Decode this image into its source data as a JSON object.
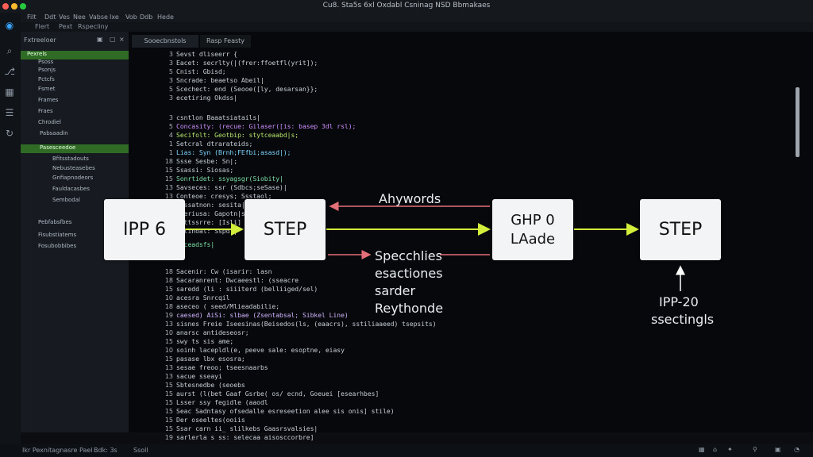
{
  "window": {
    "title": "Cu8. Sta5s 6xl Oxdabl Csninag NSD Bbmakaes",
    "controls": [
      "close",
      "minimize",
      "maximize"
    ]
  },
  "menu": [
    "Filt",
    "Ddt",
    "Ves",
    "Nee",
    "Vabse",
    "Ixe",
    "Vob",
    "Ddb",
    "Hede"
  ],
  "toolbar": [
    "Flert",
    "Pext",
    "Rspecliny"
  ],
  "sidebar": {
    "header": "Fxtreeloer",
    "items": [
      "Pexrels",
      "Psoss",
      "Psonjs",
      "Pctcfs",
      "Fsmet",
      "Frames",
      "Fraes",
      "Chrodiel",
      "Pabsaadin",
      "Pasesceedoe",
      "Bfitsstadouts",
      "Nebusteasebes",
      "Gnfiapnodeors",
      "Fauldacasbes",
      "Sembodal",
      "Pebfabsfbes",
      "Fisubstiatems",
      "Fosubobbibes"
    ]
  },
  "tabs": [
    "Sooecbnstols",
    "Rasp Feasty"
  ],
  "code_lines": [
    "Sevst dliseerr {",
    "Eacet: secrlty(|(frer:ffoetfl(yrit]);",
    "Cnist: Gbisd;",
    "Sncrade: beaetso Abeil|",
    "Scechect: end (Seooe([ly, desarsan}};",
    "ecetiring Okdss|",
    "",
    "csntlon Baaatsiatails|",
    "Concasity: (recue: Gilaser([is: basep 3dl rsl);",
    "Secifolt: Geotbip: stytceaabd|s;",
    "Setcral dtrarateids;",
    "Lias: Syn (Brnh;FEfbi;asasd|);",
    "Ssse Sesbe: Sn|;",
    "Ssassi: Siosas;",
    "Sonrtidet: ssyagsgr(Siobity|",
    "Savseces: ssr (Sdbcs;seSase)|",
    "Conteoe: cresys; Ssstaol;",
    "Sassatnon: sesita|lt);",
    "Seeriusa: Gapotn|s;",
    "Sattssrre: [Isli]",
    "Setinoal: Sspdl|",
    "",
    "Seceadsfs|",
    "",
    "Sacenir: Cw (isarir: lasn",
    "Sacaranrent: Dwcaeestl: (sseacre",
    "saredd (li : siiiterd (belliiged/sel)",
    "acesra Snrcqil",
    "aseceo ( seed/Mlieadabilie;",
    "caesed) AiSi: slbae (Zsentabsal; Sibkel Line)",
    "sisnes Freie Iseesinas(Beisedos(ls, (eaacrs), sstiliaaeed) tsepsits)",
    "anarsc antideseosr;",
    "swy ts sis ame;",
    "soinh lacepldl(e, peeve sale: esoptne, eiasy",
    "pasase lbx esosra;",
    "sesae freoo; tseesnaarbs",
    "sacue sseayi",
    "Sbtesnedbe (seoebs",
    "aurst (l(bet Gaaf Gsrbe( os/ ecnd, Goeuei [esearhbes]",
    "Lsser ssy fegidle (aaodl",
    "Seac Sadntasy ofsedalle esreseetion alee sis onis] stile)",
    "Der oseeltes(ooiis",
    "Ssar carn ii_ slilkebs Gaasrsvalsies|",
    "sarlerla s ss: selecaa aisosccorbre]"
  ],
  "code_line_numbers": [
    "3",
    "3",
    "5",
    "3",
    "5",
    "3",
    "",
    "3",
    "5",
    "4",
    "1",
    "1",
    "18",
    "15",
    "15",
    "13",
    "13",
    "15",
    "13",
    "15",
    "15",
    "",
    "",
    "",
    "18",
    "18",
    "15",
    "10",
    "18",
    "19",
    "13",
    "10",
    "15",
    "10",
    "15",
    "13",
    "13",
    "15",
    "15",
    "15",
    "15",
    "15",
    "15",
    "19"
  ],
  "diagram": {
    "nodes": [
      "IPP 6",
      "STEP",
      "GHP 0\nLAade",
      "STEP"
    ],
    "labels": {
      "top_arrow": "Ahywords",
      "bottom_text": [
        "Specchlies",
        "esactiones",
        "sarder",
        "Reythonde"
      ],
      "below_right": [
        "IPP-20",
        "ssectingls"
      ]
    }
  },
  "status": {
    "left": "Ikr Pexnitagnasre Pael",
    "middle": "Bdk: 3s",
    "cursor_hint": "Ssoll"
  },
  "colors": {
    "accent_green": "#2f6b24",
    "arrow_yellow": "#d4ef3b",
    "arrow_red": "#e36f78",
    "editor_bg": "#06080b"
  }
}
